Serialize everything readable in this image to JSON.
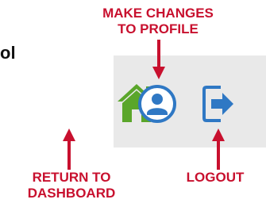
{
  "left_fragment": "ol",
  "callouts": {
    "profile": [
      "MAKE CHANGES",
      "TO PROFILE"
    ],
    "dashboard": [
      "RETURN TO",
      "DASHBOARD"
    ],
    "logout": "LOGOUT"
  },
  "icons": {
    "dashboard": "home-icon",
    "profile": "user-profile-icon",
    "logout": "logout-icon"
  },
  "colors": {
    "callout": "#c8102e",
    "home": "#5aa62a",
    "profile_logout": "#2f78c4",
    "toolbar_bg": "#e9e9e9"
  }
}
